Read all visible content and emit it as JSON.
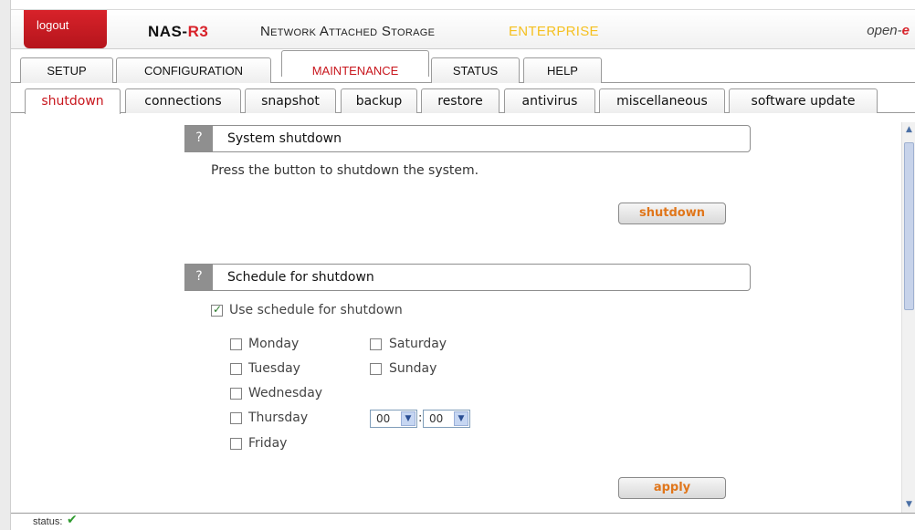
{
  "header": {
    "logout": "logout",
    "product_prefix": "NAS-",
    "product_suffix": "R3",
    "subtitle": "Network Attached Storage",
    "edition": "ENTERPRISE",
    "brand_prefix": "open-",
    "brand_suffix": "e"
  },
  "main_tabs": [
    "SETUP",
    "CONFIGURATION",
    "MAINTENANCE",
    "STATUS",
    "HELP"
  ],
  "sub_tabs": [
    "shutdown",
    "connections",
    "snapshot",
    "backup",
    "restore",
    "antivirus",
    "miscellaneous",
    "software update"
  ],
  "system_shutdown": {
    "help": "?",
    "title": "System shutdown",
    "description": "Press the button to shutdown the system.",
    "button": "shutdown"
  },
  "schedule": {
    "help": "?",
    "title": "Schedule for shutdown",
    "use_schedule_label": "Use schedule for shutdown",
    "use_schedule_checked": true,
    "days": {
      "monday": "Monday",
      "tuesday": "Tuesday",
      "wednesday": "Wednesday",
      "thursday": "Thursday",
      "friday": "Friday",
      "saturday": "Saturday",
      "sunday": "Sunday"
    },
    "hour": "00",
    "minute": "00",
    "separator": ":",
    "button": "apply"
  },
  "status": {
    "label": "status:",
    "icon": "check-icon"
  },
  "colors": {
    "brand_red": "#d8222a",
    "edition_yellow": "#f5c020",
    "button_text_orange": "#e0761b",
    "status_green": "#2f9b2f"
  }
}
